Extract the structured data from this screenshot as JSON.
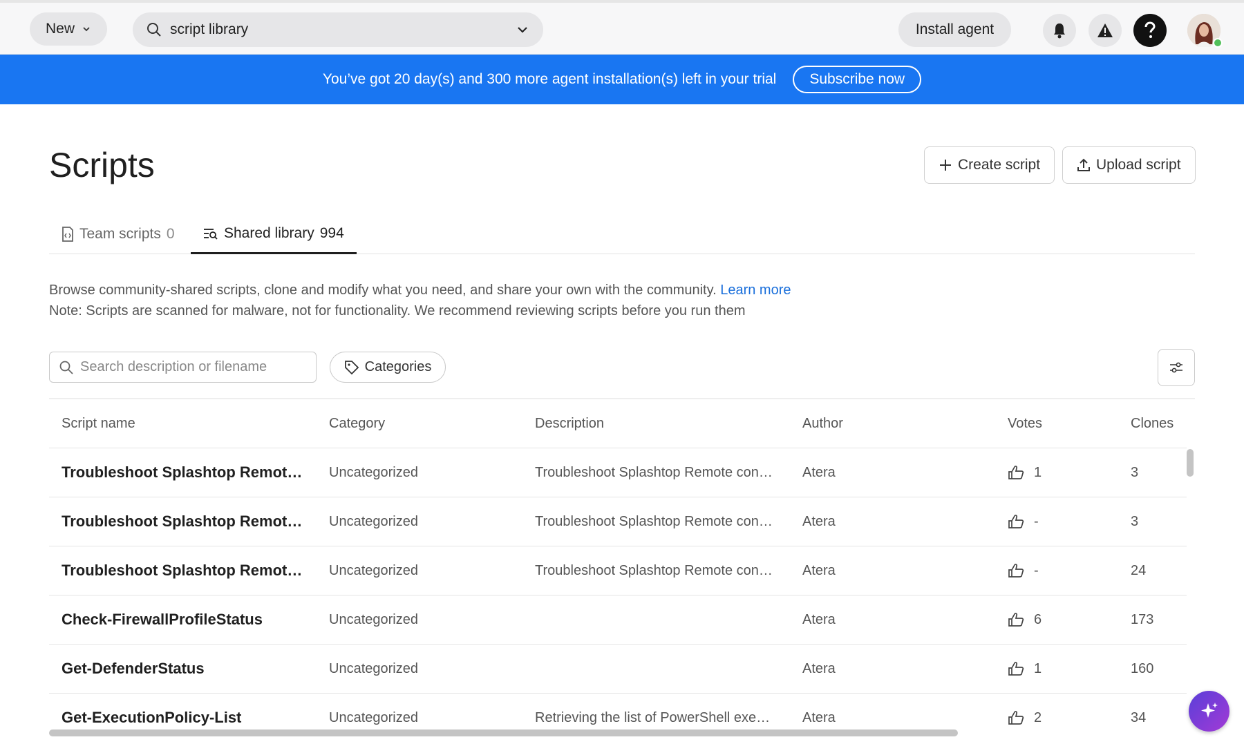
{
  "topbar": {
    "new_label": "New",
    "search_value": "script library",
    "install_label": "Install agent"
  },
  "banner": {
    "message": "You’ve got 20 day(s) and 300 more agent installation(s) left in your trial",
    "subscribe_label": "Subscribe now",
    "color": "#1976f2"
  },
  "page": {
    "title": "Scripts",
    "create_label": "Create script",
    "upload_label": "Upload script"
  },
  "tabs": [
    {
      "label": "Team scripts",
      "count": "0",
      "active": false
    },
    {
      "label": "Shared library",
      "count": "994",
      "active": true
    }
  ],
  "description": {
    "line1": "Browse community-shared scripts, clone and modify what you need, and share your own with the community.",
    "link": "Learn more",
    "line2": "Note: Scripts are scanned for malware, not for functionality. We recommend reviewing scripts before you run them"
  },
  "filters": {
    "search_placeholder": "Search description or filename",
    "categories_label": "Categories"
  },
  "table": {
    "headers": [
      "Script name",
      "Category",
      "Description",
      "Author",
      "Votes",
      "Clones"
    ],
    "rows": [
      {
        "name": "Troubleshoot Splashtop Remot…",
        "category": "Uncategorized",
        "description": "Troubleshoot Splashtop Remote con…",
        "author": "Atera",
        "votes": "1",
        "clones": "3"
      },
      {
        "name": "Troubleshoot Splashtop Remot…",
        "category": "Uncategorized",
        "description": "Troubleshoot Splashtop Remote con…",
        "author": "Atera",
        "votes": "-",
        "clones": "3"
      },
      {
        "name": "Troubleshoot Splashtop Remot…",
        "category": "Uncategorized",
        "description": "Troubleshoot Splashtop Remote con…",
        "author": "Atera",
        "votes": "-",
        "clones": "24"
      },
      {
        "name": "Check-FirewallProfileStatus",
        "category": "Uncategorized",
        "description": "",
        "author": "Atera",
        "votes": "6",
        "clones": "173"
      },
      {
        "name": "Get-DefenderStatus",
        "category": "Uncategorized",
        "description": "",
        "author": "Atera",
        "votes": "1",
        "clones": "160"
      },
      {
        "name": "Get-ExecutionPolicy-List",
        "category": "Uncategorized",
        "description": "Retrieving the list of PowerShell exe…",
        "author": "Atera",
        "votes": "2",
        "clones": "34"
      }
    ]
  }
}
